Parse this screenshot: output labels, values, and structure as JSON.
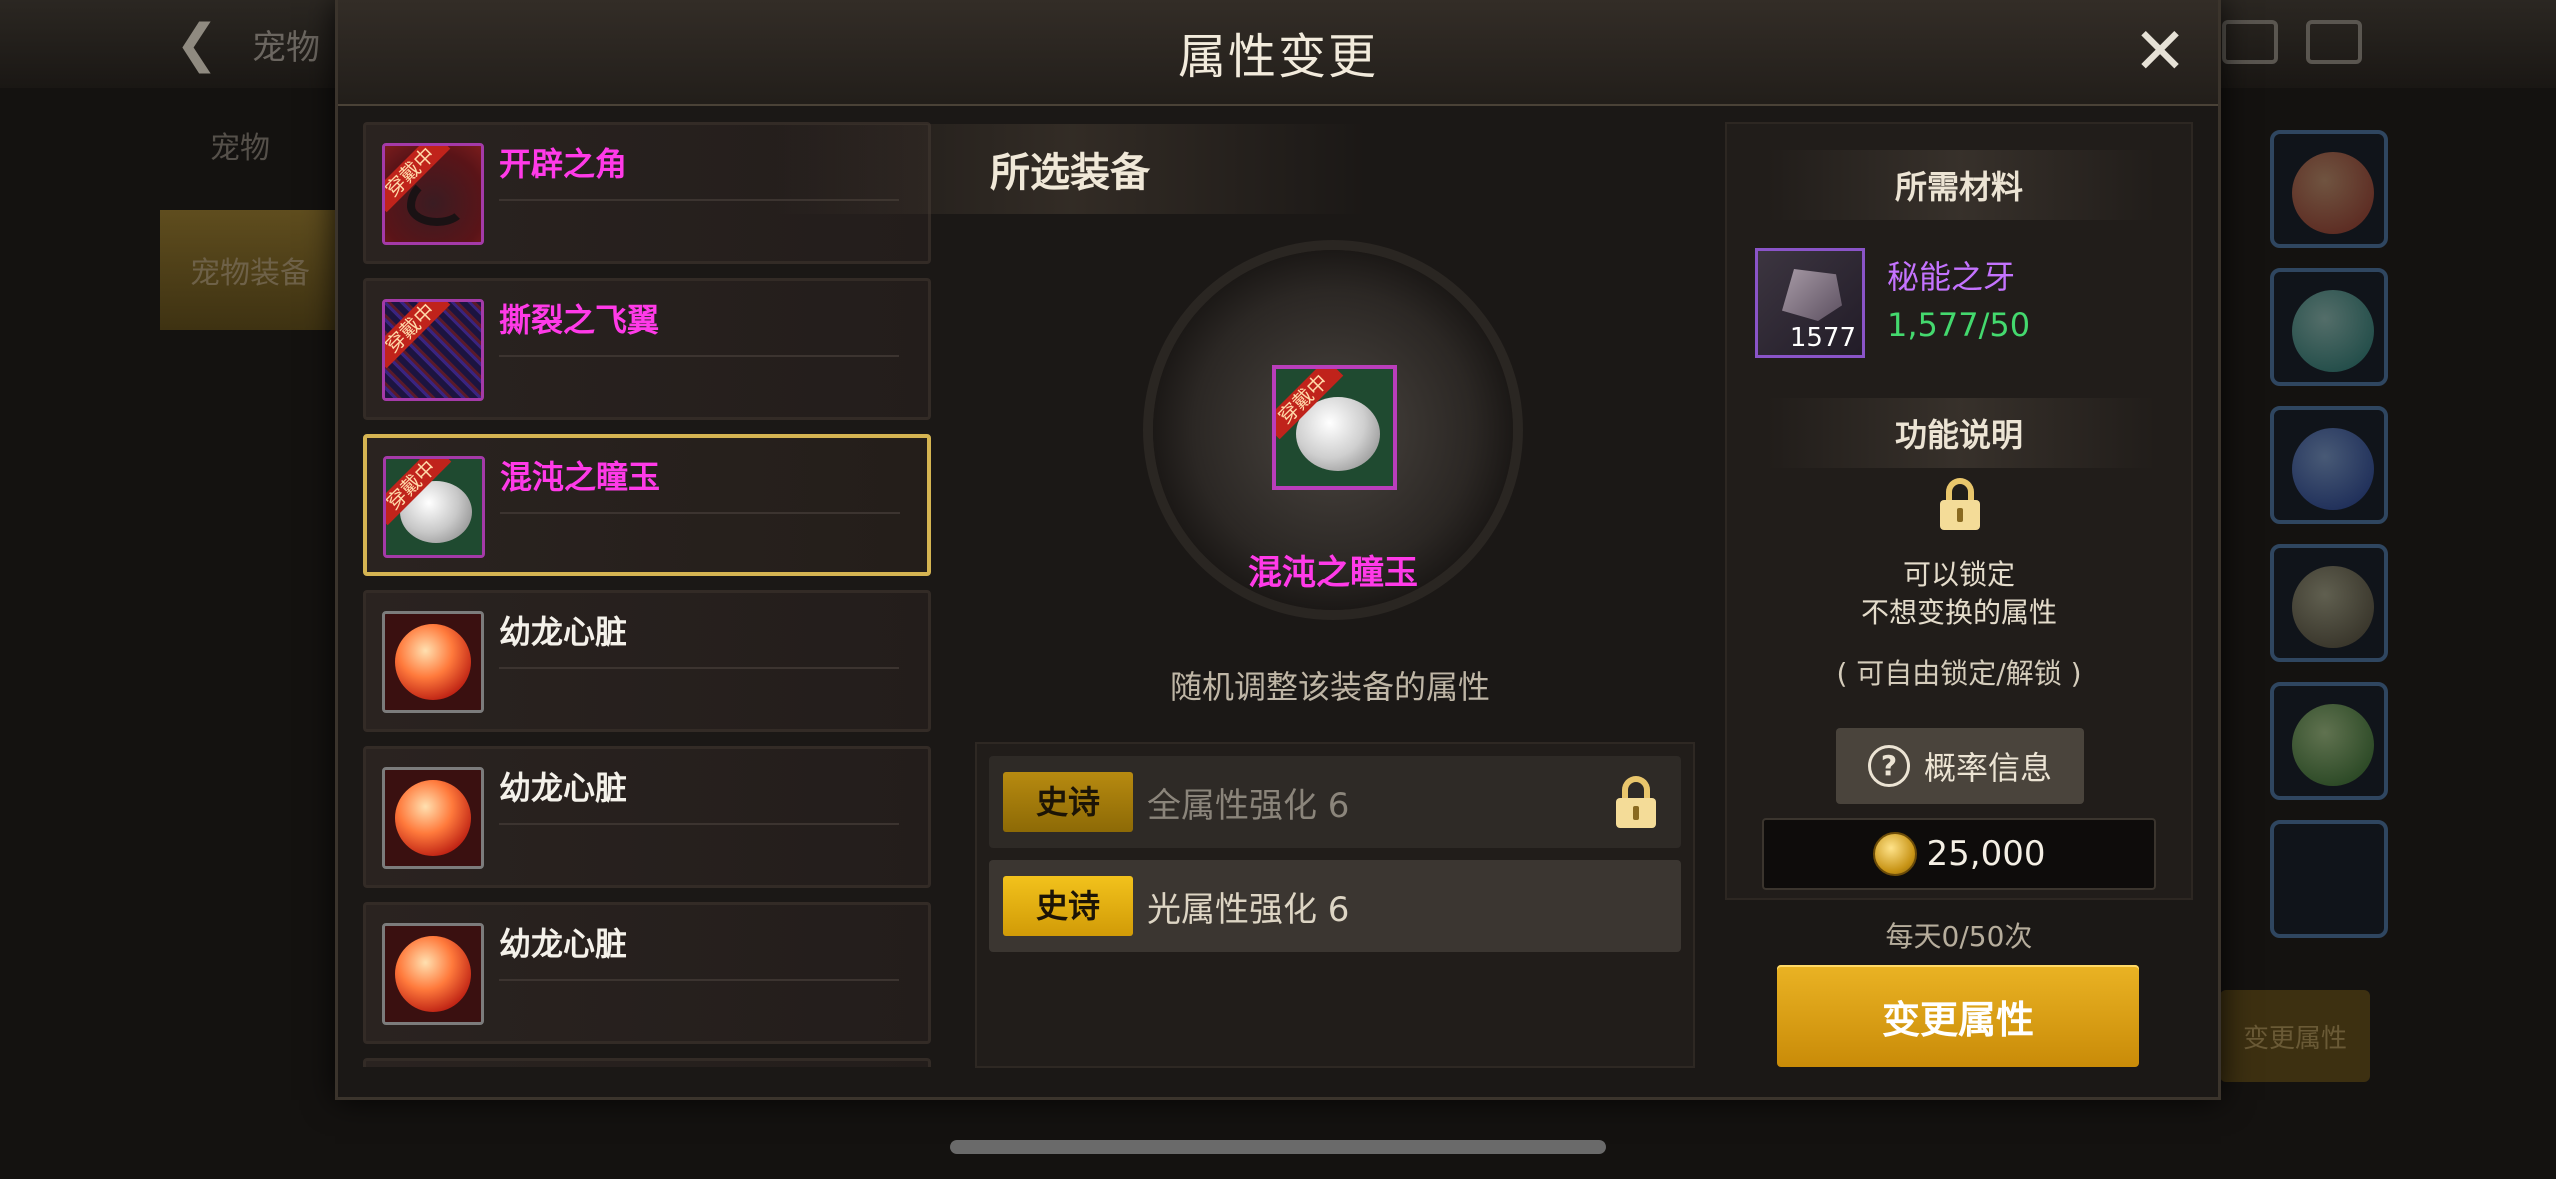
{
  "background": {
    "title": "宠物",
    "side_tabs": [
      "宠物",
      "宠物装备"
    ],
    "change_button": "变更属性"
  },
  "modal": {
    "title": "属性变更"
  },
  "item_list": [
    {
      "name": "开辟之角",
      "rarity": "epic",
      "badge": "穿戴中",
      "icon": "horn-icon"
    },
    {
      "name": "撕裂之飞翼",
      "rarity": "epic",
      "badge": "穿戴中",
      "icon": "wing-icon"
    },
    {
      "name": "混沌之瞳玉",
      "rarity": "epic",
      "badge": "穿戴中",
      "icon": "shell-orb-icon",
      "selected": true
    },
    {
      "name": "幼龙心脏",
      "rarity": "common",
      "icon": "red-orb-icon"
    },
    {
      "name": "幼龙心脏",
      "rarity": "common",
      "icon": "red-orb-icon"
    },
    {
      "name": "幼龙心脏",
      "rarity": "common",
      "icon": "red-orb-icon"
    }
  ],
  "selected_equipment": {
    "heading": "所选装备",
    "name": "混沌之瞳玉",
    "badge": "穿戴中",
    "description": "随机调整该装备的属性"
  },
  "attributes": [
    {
      "rarity": "史诗",
      "text": "全属性强化 6",
      "locked": true
    },
    {
      "rarity": "史诗",
      "text": "光属性强化 6",
      "locked": false
    }
  ],
  "materials": {
    "heading": "所需材料",
    "name": "秘能之牙",
    "owned_count": "1577",
    "quantity": "1,577/50"
  },
  "function": {
    "heading": "功能说明",
    "line1": "可以锁定",
    "line2": "不想变换的属性",
    "note": "( 可自由锁定/解锁 )"
  },
  "probability_button": "概率信息",
  "cost": "25,000",
  "daily_limit": "每天0/50次",
  "change_button": "变更属性",
  "colors": {
    "epic_name": "#ff3ae8",
    "material_name": "#c473ff",
    "material_qty": "#44d96e",
    "accent_gold": "#eab324",
    "selected_border": "#d5b452"
  }
}
